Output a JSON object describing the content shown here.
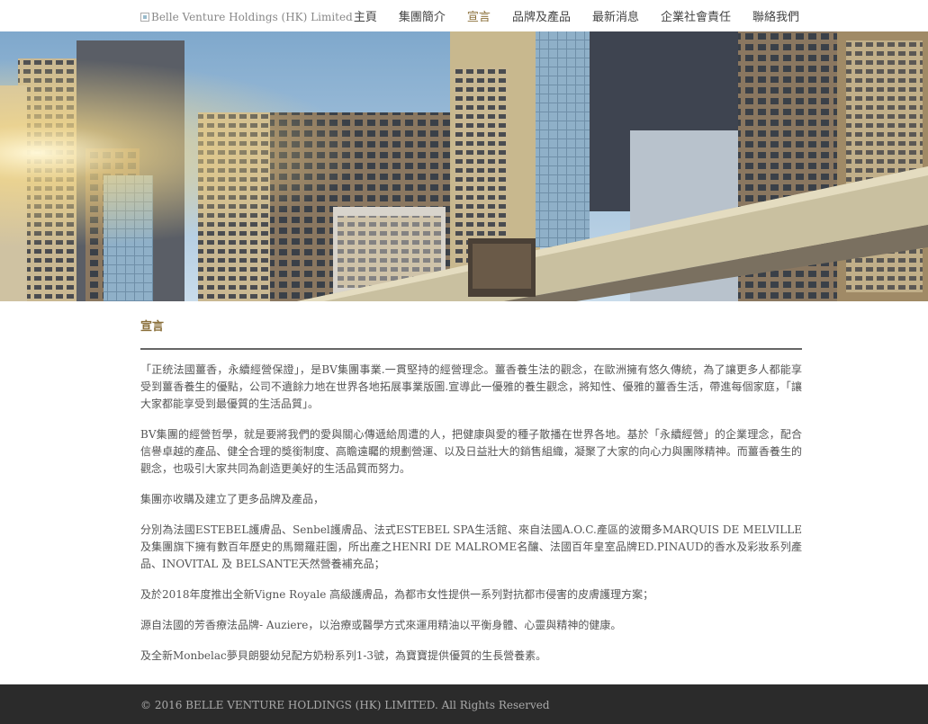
{
  "header": {
    "logo_alt": "Belle Venture Holdings (HK) Limited",
    "nav": [
      {
        "label": "主頁"
      },
      {
        "label": "集團簡介"
      },
      {
        "label": "宣言"
      },
      {
        "label": "品牌及產品"
      },
      {
        "label": "最新消息"
      },
      {
        "label": "企業社會責任"
      },
      {
        "label": "聯絡我們"
      }
    ],
    "active_nav": "宣言"
  },
  "hero": {
    "description_icon": "city-skyline-image"
  },
  "main": {
    "title": "宣言",
    "paragraphs": [
      "「正统法國薑香，永續經營保證」，是BV集團事業.一貫堅持的經營理念。薑香養生法的觀念，在歐洲擁有悠久傳統，為了讓更多人都能享受到薑香養生的優點，公司不遺餘力地在世界各地拓展事業版圖.宣導此一優雅的養生觀念，將知性、優雅的薑香生活，帶進每個家庭，「讓大家都能享受到最優質的生活品質」。",
      "BV集團的經營哲學，就是要將我們的愛與關心傳遞給周遭的人，把健康與愛的種子散播在世界各地。基於「永續經營」的企業理念，配合信譽卓越的產品、健全合理的獎銜制度、高瞻遠矚的規劃營運、以及日益壯大的銷售組織，凝聚了大家的向心力與團隊精神。而薑香養生的觀念，也吸引大家共同為創造更美好的生活品質而努力。",
      "集團亦收購及建立了更多品牌及產品，",
      "分別為法國ESTEBEL護膚品、Senbel護膚品、法式ESTEBEL SPA生活館、來自法國A.O.C.產區的波爾多MARQUIS DE MELVILLE及集團旗下擁有數百年歷史的馬爾羅莊園，所出產之HENRI DE MALROME名釀、法國百年皇室品牌ED.PINAUD的香水及彩妝系列產品、INOVITAL 及 BELSANTE天然營養補充品；",
      "及於2018年度推出全新Vigne Royale 高級護膚品，為都市女性提供一系列對抗都市侵害的皮膚護理方案；",
      "源自法國的芳香療法品牌- Auziere，以治療或醫學方式來運用精油以平衡身體、心靈與精神的健康。",
      "及全新Monbelac夢貝朗嬰幼兒配方奶粉系列1-3號，為寶寶提供優質的生長營養素。"
    ]
  },
  "footer": {
    "copyright": "© 2016 BELLE VENTURE HOLDINGS (HK) LIMITED. All Rights Reserved"
  },
  "colors": {
    "accent": "#8a6f3a",
    "footer_bg": "#2b2b2b"
  }
}
